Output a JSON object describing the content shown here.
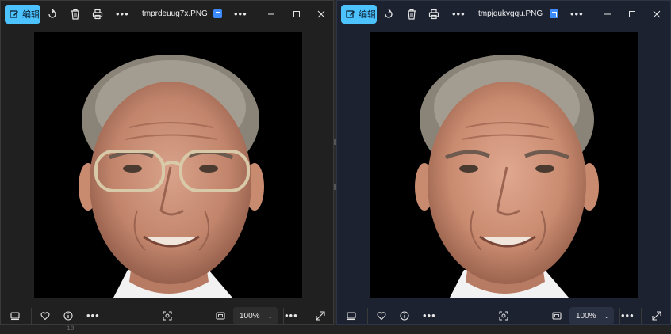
{
  "windows": [
    {
      "id": "left",
      "edit_label": "编辑",
      "filename": "tmprdeuug7x.PNG",
      "zoom": "100%",
      "photo": {
        "subject": "older man with glasses",
        "glasses": true
      }
    },
    {
      "id": "right",
      "edit_label": "编辑",
      "filename": "tmpjqukvgqu.PNG",
      "zoom": "100%",
      "photo": {
        "subject": "older man without glasses",
        "glasses": false
      }
    }
  ],
  "background_text": {
    "line_number": "10"
  },
  "icons": {
    "edit": "edit-icon",
    "rotate": "rotate-icon",
    "delete": "trash-icon",
    "print": "print-icon",
    "more": "more-icon",
    "edit_with": "edit-with-icon",
    "minimize": "minimize-icon",
    "maximize": "maximize-icon",
    "close": "close-icon",
    "filmstrip": "filmstrip-icon",
    "favorite": "heart-icon",
    "info": "info-icon",
    "select": "visual-search-icon",
    "fit": "fit-window-icon",
    "fullscreen": "fullscreen-icon"
  },
  "colors": {
    "accent": "#4cc2ff",
    "left_window_bg": "#202020",
    "right_window_bg": "#1c2230",
    "canvas_bg": "#000000"
  }
}
